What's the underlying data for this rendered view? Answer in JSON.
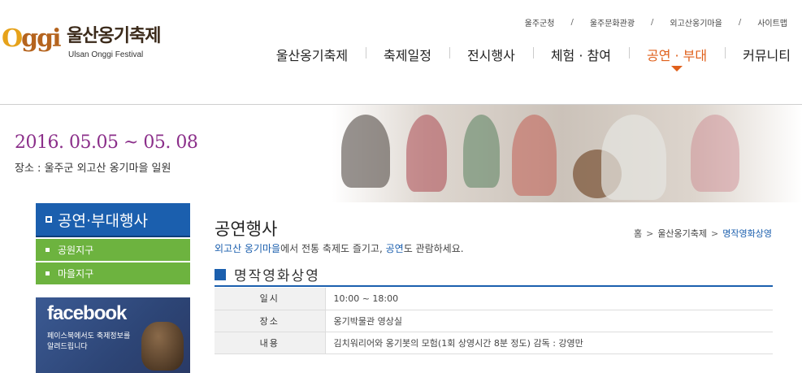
{
  "header": {
    "logo_ko": "울산옹기축제",
    "logo_en": "Ulsan Onggi Festival",
    "util_links": [
      "울주군청",
      "울주문화관광",
      "외고산옹기마을",
      "사이트맵"
    ],
    "util_sep": "/"
  },
  "nav": {
    "items": [
      "울산옹기축제",
      "축제일정",
      "전시행사",
      "체험 · 참여",
      "공연 · 부대",
      "커뮤니티"
    ],
    "active_index": 4
  },
  "banner": {
    "date": "2016. 05.05 ~ 05. 08",
    "place": "장소 : 울주군 외고산 옹기마을 일원"
  },
  "sidebar": {
    "title": "공연·부대행사",
    "items": [
      "공원지구",
      "마을지구"
    ]
  },
  "facebook": {
    "logo": "facebook",
    "line1": "페이스북에서도 축제정보를",
    "line2": "알려드립니다"
  },
  "content": {
    "title": "공연행사",
    "desc_hl1": "외고산 옹기마을",
    "desc_mid": "에서 전통 축제도 즐기고, ",
    "desc_hl2": "공연",
    "desc_end": "도 관람하세요.",
    "section_title": "명작영화상영"
  },
  "breadcrumb": [
    "홈",
    "울산옹기축제",
    "명작영화상영"
  ],
  "breadcrumb_sep": ">",
  "table": {
    "rows": [
      {
        "label": "일시",
        "value": "10:00 ~ 18:00"
      },
      {
        "label": "장소",
        "value": "옹기박물관 영상실"
      },
      {
        "label": "내용",
        "value": "김치워리어와 옹기봇의 모험(1회 상영시간 8분 정도) 감독 : 강영만"
      }
    ]
  },
  "colors": {
    "primary_blue": "#1b5fae",
    "accent_orange": "#e0601b",
    "sidebar_green": "#6db33f",
    "date_purple": "#8b2f8a",
    "facebook_blue": "#3b5a93"
  }
}
